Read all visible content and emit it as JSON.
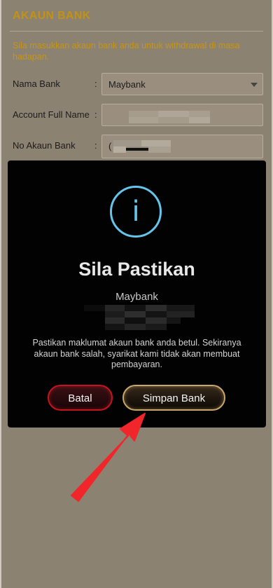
{
  "page": {
    "title": "AKAUN BANK",
    "intro": "Sila masukkan akaun bank anda untuk withdrawal di masa hadapan."
  },
  "form": {
    "bank_label": "Nama Bank",
    "bank_value": "Maybank",
    "name_label": "Account Full Name",
    "account_label": "No Akaun Bank",
    "account_value_prefix": "(",
    "separator": ":"
  },
  "modal": {
    "icon": "info-icon",
    "icon_glyph": "i",
    "title": "Sila Pastikan",
    "bank": "Maybank",
    "message": "Pastikan maklumat akaun bank anda betul. Sekiranya akaun bank salah, syarikat kami tidak akan membuat pembayaran.",
    "cancel_label": "Batal",
    "save_label": "Simpan Bank"
  },
  "colors": {
    "accent_gold": "#c29215",
    "info_blue": "#64c5ea",
    "cancel_red": "#c4141d",
    "save_gold": "#caa66c",
    "arrow_red": "#f0262a"
  }
}
